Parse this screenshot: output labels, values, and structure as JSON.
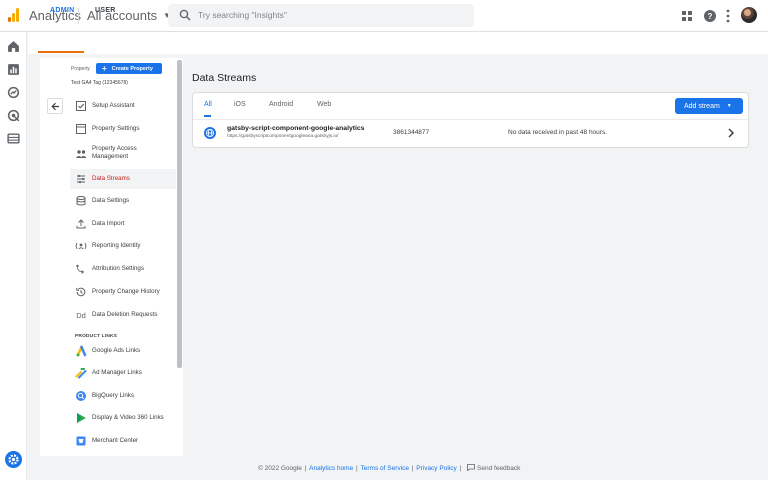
{
  "header": {
    "app_title": "Analytics",
    "account_label": "All accounts",
    "search_placeholder": "Try searching \"Insights\""
  },
  "tabs": {
    "admin": "ADMIN",
    "user": "USER"
  },
  "property": {
    "label": "Property",
    "create_button": "Create Property",
    "name": "Test GA4 Tag (12345678)"
  },
  "sidebar": {
    "items": [
      {
        "label": "Setup Assistant",
        "icon": "checklist-icon"
      },
      {
        "label": "Property Settings",
        "icon": "settings-square-icon"
      },
      {
        "label": "Property Access Management",
        "icon": "people-icon"
      },
      {
        "label": "Data Streams",
        "icon": "streams-icon",
        "active": true
      },
      {
        "label": "Data Settings",
        "icon": "database-icon"
      },
      {
        "label": "Data Import",
        "icon": "upload-icon"
      },
      {
        "label": "Reporting Identity",
        "icon": "identity-icon"
      },
      {
        "label": "Attribution Settings",
        "icon": "attribution-icon"
      },
      {
        "label": "Property Change History",
        "icon": "history-icon"
      },
      {
        "label": "Data Deletion Requests",
        "icon": "dd-icon"
      }
    ],
    "product_links_heading": "PRODUCT LINKS",
    "links": [
      {
        "label": "Google Ads Links",
        "icon": "google-ads-icon"
      },
      {
        "label": "Ad Manager Links",
        "icon": "ad-manager-icon"
      },
      {
        "label": "BigQuery Links",
        "icon": "bigquery-icon"
      },
      {
        "label": "Display & Video 360 Links",
        "icon": "dv360-icon"
      },
      {
        "label": "Merchant Center",
        "icon": "merchant-center-icon"
      }
    ]
  },
  "main": {
    "title": "Data Streams",
    "stream_tabs": [
      "All",
      "iOS",
      "Android",
      "Web"
    ],
    "add_stream_button": "Add stream",
    "streams": [
      {
        "name": "gatsby-script-component-google-analytics",
        "url": "https://gatsbyscriptcomponentgoogleana.gatsbyjs.io/",
        "id": "3861344877",
        "status": "No data received in past 48 hours."
      }
    ]
  },
  "footer": {
    "copyright": "© 2022 Google",
    "links": [
      "Analytics home",
      "Terms of Service",
      "Privacy Policy"
    ],
    "feedback": "Send feedback"
  },
  "colors": {
    "accent": "#1a73e8",
    "active_nav_text": "#c5221f",
    "admin_tab_underline": "#e8710a"
  }
}
